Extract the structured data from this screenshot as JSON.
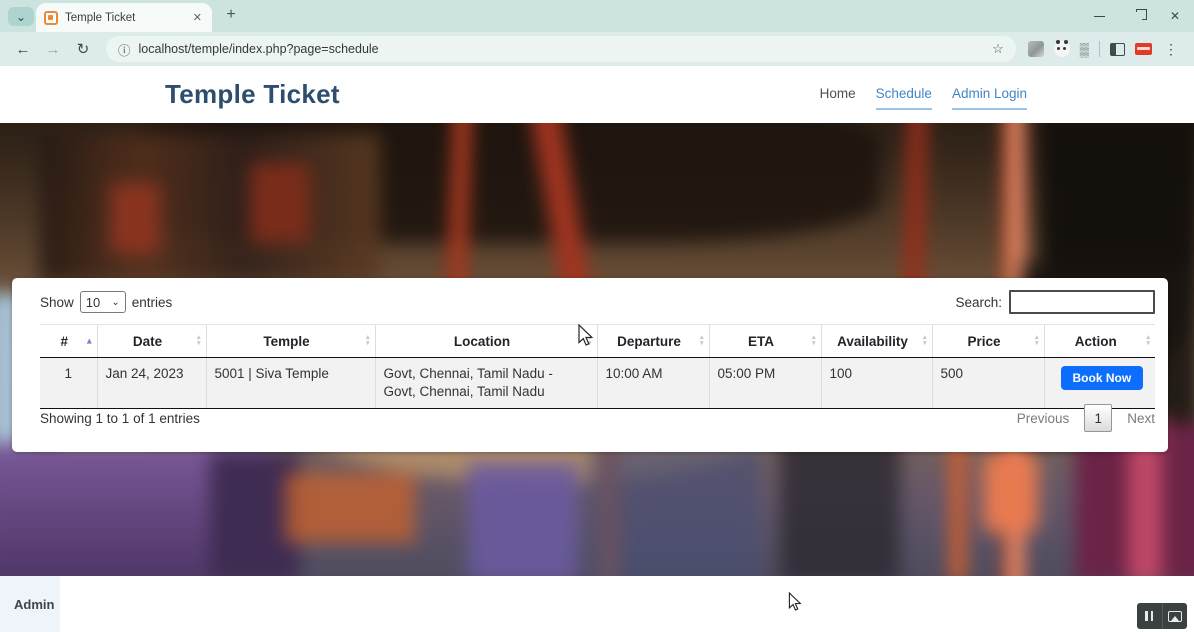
{
  "browser": {
    "tab_title": "Temple Ticket",
    "url": "localhost/temple/index.php?page=schedule"
  },
  "icons": {
    "chevron_down": "⌄",
    "tab_close": "✕",
    "new_tab": "+",
    "window_close": "✕",
    "back": "←",
    "forward": "→",
    "reload": "↻",
    "info": "ⓘ",
    "star": "☆",
    "menu": "⋮",
    "sort_up": "▴",
    "sort_down": "▾"
  },
  "header": {
    "brand": "Temple Ticket",
    "nav": [
      {
        "label": "Home",
        "active": false
      },
      {
        "label": "Schedule",
        "active": true
      },
      {
        "label": "Admin Login",
        "active": true
      }
    ]
  },
  "table": {
    "show_label": "Show",
    "page_length": "10",
    "entries_label": "entries",
    "search_label": "Search:",
    "search_value": "",
    "columns": [
      {
        "label": "#",
        "sort": "asc"
      },
      {
        "label": "Date",
        "sort": "both"
      },
      {
        "label": "Temple",
        "sort": "both"
      },
      {
        "label": "Location",
        "sort": "both"
      },
      {
        "label": "Departure",
        "sort": "both"
      },
      {
        "label": "ETA",
        "sort": "both"
      },
      {
        "label": "Availability",
        "sort": "both"
      },
      {
        "label": "Price",
        "sort": "both"
      },
      {
        "label": "Action",
        "sort": "both"
      }
    ],
    "rows": [
      {
        "num": "1",
        "date": "Jan 24, 2023",
        "temple": "5001 | Siva Temple",
        "location": "Govt, Chennai, Tamil Nadu - Govt, Chennai, Tamil Nadu",
        "departure": "10:00 AM",
        "eta": "05:00 PM",
        "availability": "100",
        "price": "500",
        "action_label": "Book Now"
      }
    ],
    "info": "Showing 1 to 1 of 1 entries",
    "pagination": {
      "previous": "Previous",
      "current": "1",
      "next": "Next"
    }
  },
  "footer": {
    "admin_label": "Admin"
  },
  "colors": {
    "accent": "#0d6efd",
    "brand_text": "#2e4e6e",
    "nav_link": "#4285c4",
    "nav_underline": "#9cc3ea",
    "chrome_bg": "#cde3e0",
    "sort_active": "#8080d0",
    "row_stripe": "#f2f2f2"
  }
}
